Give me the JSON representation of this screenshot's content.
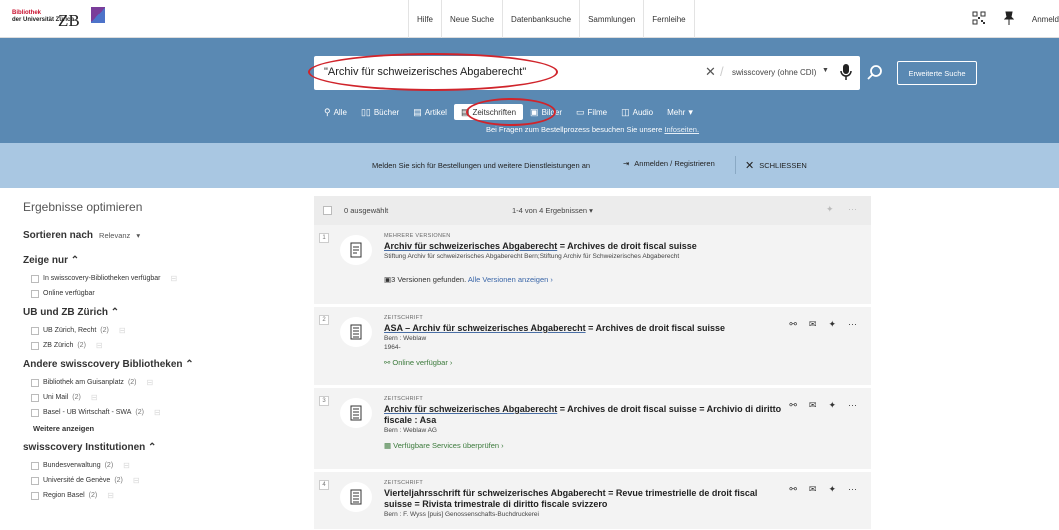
{
  "header": {
    "logo_left_lines": [
      "Bibliothek",
      "der Universität Zürich"
    ],
    "logo_right": "ZB",
    "nav": [
      "Hilfe",
      "Neue Suche",
      "Datenbanksuche",
      "Sammlungen",
      "Fernleihe"
    ],
    "login_cut": "Anmeld"
  },
  "search": {
    "query": "\"Archiv für schweizerisches Abgaberecht\"",
    "scope": "swisscovery (ohne CDI)",
    "advanced_label": "Erweiterte Suche"
  },
  "media_tabs": [
    {
      "label": "Alle",
      "icon": "search-icon"
    },
    {
      "label": "Bücher",
      "icon": "book-icon"
    },
    {
      "label": "Artikel",
      "icon": "article-icon"
    },
    {
      "label": "Zeitschriften",
      "icon": "journal-icon",
      "active": true
    },
    {
      "label": "Bilder",
      "icon": "image-icon"
    },
    {
      "label": "Filme",
      "icon": "film-icon"
    },
    {
      "label": "Audio",
      "icon": "audio-icon"
    },
    {
      "label": "Mehr",
      "icon": "chevron-down-icon"
    }
  ],
  "band_note": {
    "text": "Bei Fragen zum Bestellprozess besuchen Sie unsere ",
    "link": "Infoseiten."
  },
  "login_strip": {
    "message": "Melden Sie sich für Bestellungen und weitere Dienstleistungen an",
    "login": "Anmelden / Registrieren",
    "close": "SCHLIESSEN"
  },
  "sidebar": {
    "title": "Ergebnisse optimieren",
    "sort_label": "Sortieren nach",
    "sort_value": "Relevanz",
    "groups": [
      {
        "title": "Zeige nur",
        "items": [
          {
            "label": "In swisscovery-Bibliotheken verfügbar",
            "count": ""
          },
          {
            "label": "Online verfügbar",
            "count": ""
          }
        ]
      },
      {
        "title": "UB und ZB Zürich",
        "items": [
          {
            "label": "UB Zürich, Recht",
            "count": "(2)"
          },
          {
            "label": "ZB Zürich",
            "count": "(2)"
          }
        ]
      },
      {
        "title": "Andere swisscovery Bibliotheken",
        "items": [
          {
            "label": "Bibliothek am Guisanplatz",
            "count": "(2)"
          },
          {
            "label": "Uni Mail",
            "count": "(2)"
          },
          {
            "label": "Basel - UB Wirtschaft - SWA",
            "count": "(2)"
          }
        ],
        "more": "Weitere anzeigen"
      },
      {
        "title": "swisscovery Institutionen",
        "items": [
          {
            "label": "Bundesverwaltung",
            "count": "(2)"
          },
          {
            "label": "Université de Genève",
            "count": "(2)"
          },
          {
            "label": "Region Basel",
            "count": "(2)"
          }
        ]
      }
    ]
  },
  "results_header": {
    "selected": "0 ausgewählt",
    "count": "1-4 von 4 Ergebnissen"
  },
  "results": [
    {
      "num": "1",
      "type": "MEHRERE VERSIONEN",
      "title_a": "Archiv für schweizerisches Abgaberecht",
      "title_b": " = Archives de droit fiscal suisse",
      "line1": "Stiftung Archiv für schweizerisches Abgaberecht Bern;Stiftung Archiv für Schweizerisches Abgaberecht",
      "line2": "",
      "link_pre": "3 Versionen gefunden. ",
      "link": "Alle Versionen anzeigen ›"
    },
    {
      "num": "2",
      "type": "ZEITSCHRIFT",
      "title_a": "ASA – Archiv für schweizerisches Abgaberecht",
      "title_b": " = Archives de droit fiscal suisse",
      "line1": "Bern : Weblaw",
      "line2": "1964-",
      "link_pre": "",
      "link": "Online verfügbar ›"
    },
    {
      "num": "3",
      "type": "ZEITSCHRIFT",
      "title_a": "Archiv für schweizerisches Abgaberecht",
      "title_b": " = Archives de droit fiscal suisse = Archivio di diritto fiscale : Asa",
      "line1": "Bern : Weblaw AG",
      "line2": "",
      "link_pre": "",
      "link": "Verfügbare Services überprüfen ›"
    },
    {
      "num": "4",
      "type": "ZEITSCHRIFT",
      "title_a": "Vierteljahrsschrift für schweizerisches Abgaberecht",
      "title_b": " = Revue trimestrielle de droit fiscal suisse = Rivista trimestrale di diritto fiscale svizzero",
      "line1": "Bern : F. Wyss [puis] Genossenschafts-Buchdruckerei",
      "line2": "",
      "link_pre": "",
      "link": ""
    }
  ],
  "colors": {
    "band": "#5a89b3",
    "strip": "#a9c7e2",
    "highlight": "#d0242b"
  }
}
